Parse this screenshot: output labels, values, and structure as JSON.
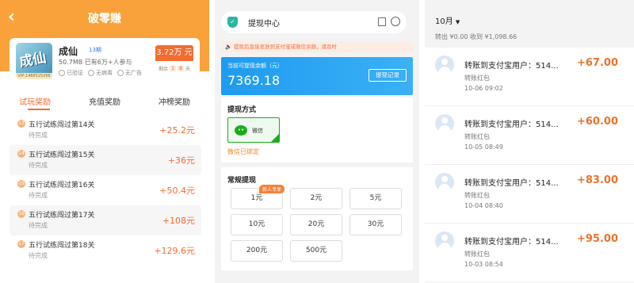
{
  "game_screen": {
    "title": "破零赚",
    "game": {
      "name": "成仙",
      "period": "13期",
      "size": "50.7MB 已有6万+人参与",
      "icon_text": "成仙",
      "vip_text": "VIP:1488525266",
      "tags": [
        "已验证",
        "无病毒",
        "无广告"
      ],
      "price": "3.72万 元",
      "remaining_label": "剩余",
      "remaining_digits": [
        "1",
        "8"
      ],
      "remaining_unit": "天"
    },
    "tabs": [
      "试玩奖励",
      "充值奖励",
      "冲榜奖励"
    ],
    "tasks": [
      {
        "num": "13",
        "title": "五行试练闯过第14关",
        "status": "待完成",
        "reward": "+25.2元"
      },
      {
        "num": "14",
        "title": "五行试练闯过第15关",
        "status": "待完成",
        "reward": "+36元"
      },
      {
        "num": "15",
        "title": "五行试练闯过第16关",
        "status": "待完成",
        "reward": "+50.4元"
      },
      {
        "num": "16",
        "title": "五行试练闯过第17关",
        "status": "待完成",
        "reward": "+108元"
      },
      {
        "num": "17",
        "title": "五行试练闯过第18关",
        "status": "待完成",
        "reward": "+129.6元"
      }
    ]
  },
  "withdraw_screen": {
    "title": "提现中心",
    "notice": "提现后直接发放到支付宝或微信余额，请及时",
    "balance_label": "当前可提现余额（元）",
    "balance": "7369.18",
    "records_button": "提现记录",
    "method_title": "提现方式",
    "method_option": "微信",
    "method_bound": "微信已绑定",
    "regular_title": "常规提现",
    "new_user_tag": "新人专享",
    "amounts": [
      "1元",
      "2元",
      "5元",
      "10元",
      "20元",
      "30元",
      "200元",
      "500元"
    ]
  },
  "records_screen": {
    "month": "10月",
    "summary": "转出 ¥0.00   收到 ¥1,098.66",
    "transactions": [
      {
        "title": "转账到支付宝用户：514...",
        "sub": "转账红包",
        "date": "10-06  09:02",
        "amount": "+67.00"
      },
      {
        "title": "转账到支付宝用户：514...",
        "sub": "转账红包",
        "date": "10-05  08:49",
        "amount": "+60.00"
      },
      {
        "title": "转账到支付宝用户：514...",
        "sub": "转账红包",
        "date": "10-04  08:40",
        "amount": "+83.00"
      },
      {
        "title": "转账到支付宝用户：514...",
        "sub": "转账红包",
        "date": "10-03  08:54",
        "amount": "+95.00"
      }
    ]
  },
  "colors": {
    "orange": "#f9a23b",
    "accent": "#f36c31",
    "blue": "#1e9bf0",
    "green": "#1aad19"
  }
}
